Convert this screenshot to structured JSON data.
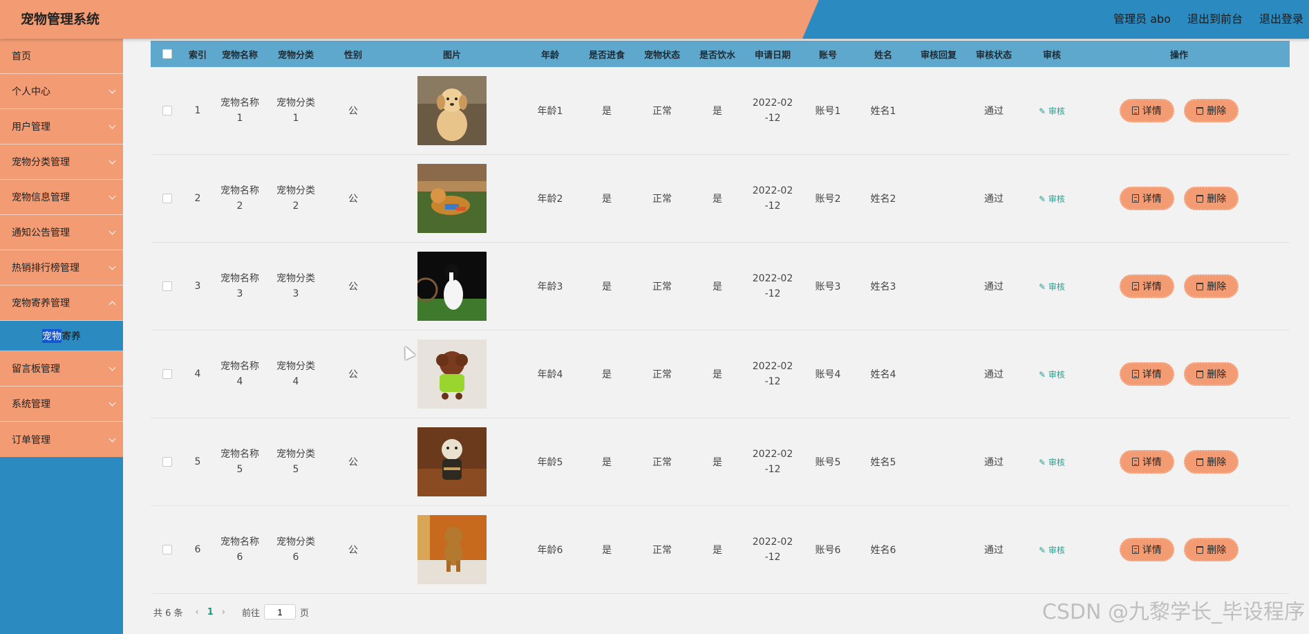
{
  "header": {
    "title": "宠物管理系统",
    "admin": "管理员 abo",
    "to_front": "退出到前台",
    "logout": "退出登录"
  },
  "sidebar": {
    "items": [
      {
        "label": "首页"
      },
      {
        "label": "个人中心"
      },
      {
        "label": "用户管理"
      },
      {
        "label": "宠物分类管理"
      },
      {
        "label": "宠物信息管理"
      },
      {
        "label": "通知公告管理"
      },
      {
        "label": "热销排行榜管理"
      },
      {
        "label": "宠物寄养管理"
      },
      {
        "label": "留言板管理"
      },
      {
        "label": "系统管理"
      },
      {
        "label": "订单管理"
      }
    ],
    "sub_item": {
      "highlight": "宠物",
      "rest": "寄养"
    }
  },
  "table": {
    "headers": [
      "索引",
      "宠物名称",
      "宠物分类",
      "性别",
      "图片",
      "年龄",
      "是否进食",
      "宠物状态",
      "是否饮水",
      "申请日期",
      "账号",
      "姓名",
      "审核回复",
      "审核状态",
      "审核",
      "操作"
    ],
    "rows": [
      {
        "index": "1",
        "name_a": "宠物名称",
        "name_b": "1",
        "cat_a": "宠物分类",
        "cat_b": "1",
        "gender": "公",
        "age": "年龄1",
        "eating": "是",
        "status": "正常",
        "drinking": "是",
        "date_a": "2022-02",
        "date_b": "-12",
        "account": "账号1",
        "realname": "姓名1",
        "reply": "",
        "audit_status": "通过",
        "audit": "审核",
        "detail": "详情",
        "delete": "删除"
      },
      {
        "index": "2",
        "name_a": "宠物名称",
        "name_b": "2",
        "cat_a": "宠物分类",
        "cat_b": "2",
        "gender": "公",
        "age": "年龄2",
        "eating": "是",
        "status": "正常",
        "drinking": "是",
        "date_a": "2022-02",
        "date_b": "-12",
        "account": "账号2",
        "realname": "姓名2",
        "reply": "",
        "audit_status": "通过",
        "audit": "审核",
        "detail": "详情",
        "delete": "删除"
      },
      {
        "index": "3",
        "name_a": "宠物名称",
        "name_b": "3",
        "cat_a": "宠物分类",
        "cat_b": "3",
        "gender": "公",
        "age": "年龄3",
        "eating": "是",
        "status": "正常",
        "drinking": "是",
        "date_a": "2022-02",
        "date_b": "-12",
        "account": "账号3",
        "realname": "姓名3",
        "reply": "",
        "audit_status": "通过",
        "audit": "审核",
        "detail": "详情",
        "delete": "删除"
      },
      {
        "index": "4",
        "name_a": "宠物名称",
        "name_b": "4",
        "cat_a": "宠物分类",
        "cat_b": "4",
        "gender": "公",
        "age": "年龄4",
        "eating": "是",
        "status": "正常",
        "drinking": "是",
        "date_a": "2022-02",
        "date_b": "-12",
        "account": "账号4",
        "realname": "姓名4",
        "reply": "",
        "audit_status": "通过",
        "audit": "审核",
        "detail": "详情",
        "delete": "删除"
      },
      {
        "index": "5",
        "name_a": "宠物名称",
        "name_b": "5",
        "cat_a": "宠物分类",
        "cat_b": "5",
        "gender": "公",
        "age": "年龄5",
        "eating": "是",
        "status": "正常",
        "drinking": "是",
        "date_a": "2022-02",
        "date_b": "-12",
        "account": "账号5",
        "realname": "姓名5",
        "reply": "",
        "audit_status": "通过",
        "audit": "审核",
        "detail": "详情",
        "delete": "删除"
      },
      {
        "index": "6",
        "name_a": "宠物名称",
        "name_b": "6",
        "cat_a": "宠物分类",
        "cat_b": "6",
        "gender": "公",
        "age": "年龄6",
        "eating": "是",
        "status": "正常",
        "drinking": "是",
        "date_a": "2022-02",
        "date_b": "-12",
        "account": "账号6",
        "realname": "姓名6",
        "reply": "",
        "audit_status": "通过",
        "audit": "审核",
        "detail": "详情",
        "delete": "删除"
      }
    ]
  },
  "pagination": {
    "total": "共 6 条",
    "current": "1",
    "goto_label": "前往",
    "goto_value": "1",
    "page_label": "页"
  },
  "watermark": "CSDN @九黎学长_毕设程序",
  "colors": {
    "accent": "#f39b72",
    "blue": "#2b8bc0",
    "table_header": "#5ea8cd",
    "audit": "#2a9d8f"
  },
  "pet_images": [
    "puppy-photo",
    "dog-playing-photo",
    "border-collie-photo",
    "poodle-photo",
    "dressed-puppy-photo",
    "poodle-standing-photo"
  ]
}
